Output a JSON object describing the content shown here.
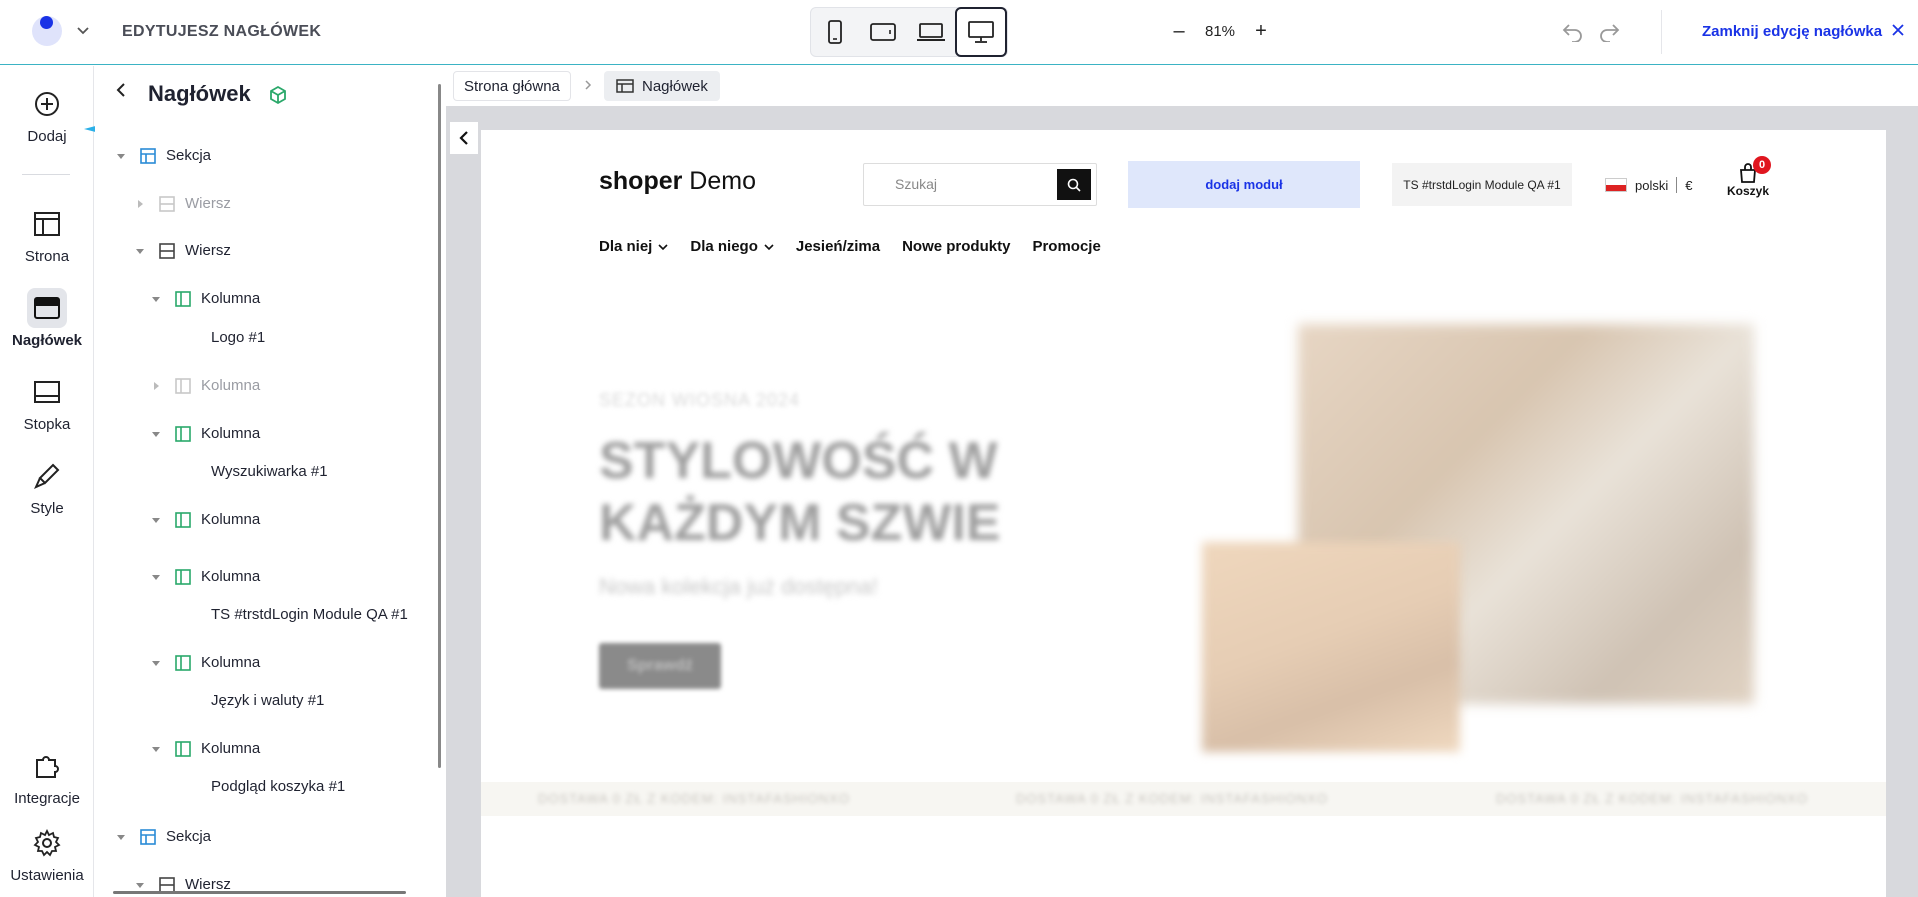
{
  "topbar": {
    "editing_label": "EDYTUJESZ NAGŁÓWEK",
    "devices": [
      "phone",
      "tablet",
      "laptop",
      "desktop"
    ],
    "active_device": "desktop",
    "zoom": "81%",
    "close_label": "Zamknij edycję nagłówka"
  },
  "rail": {
    "items": [
      {
        "label": "Dodaj",
        "icon": "plus-circle-icon"
      },
      {
        "label": "Strona",
        "icon": "layout-icon"
      },
      {
        "label": "Nagłówek",
        "icon": "header-icon",
        "active": true
      },
      {
        "label": "Stopka",
        "icon": "footer-icon"
      },
      {
        "label": "Style",
        "icon": "brush-icon"
      },
      {
        "label": "Integracje",
        "icon": "puzzle-icon"
      },
      {
        "label": "Ustawienia",
        "icon": "gear-icon"
      }
    ]
  },
  "tree": {
    "title": "Nagłówek",
    "nodes": [
      {
        "label": "Sekcja",
        "type": "section"
      },
      {
        "label": "Wiersz",
        "type": "row",
        "dim": true
      },
      {
        "label": "Wiersz",
        "type": "row"
      },
      {
        "label": "Kolumna",
        "type": "column"
      },
      {
        "label": "Logo #1",
        "type": "module"
      },
      {
        "label": "Kolumna",
        "type": "column",
        "dim": true
      },
      {
        "label": "Kolumna",
        "type": "column"
      },
      {
        "label": "Wyszukiwarka #1",
        "type": "module"
      },
      {
        "label": "Kolumna",
        "type": "column"
      },
      {
        "label": "Kolumna",
        "type": "column"
      },
      {
        "label": "TS #trstdLogin Module QA #1",
        "type": "module"
      },
      {
        "label": "Kolumna",
        "type": "column"
      },
      {
        "label": "Język i waluty #1",
        "type": "module"
      },
      {
        "label": "Kolumna",
        "type": "column"
      },
      {
        "label": "Podgląd koszyka #1",
        "type": "module"
      },
      {
        "label": "Sekcja",
        "type": "section"
      },
      {
        "label": "Wiersz",
        "type": "row"
      }
    ]
  },
  "breadcrumb": {
    "home": "Strona główna",
    "current": "Nagłówek"
  },
  "preview": {
    "brand_bold": "shoper",
    "brand_rest": " Demo",
    "search_placeholder": "Szukaj",
    "module_label": "dodaj moduł",
    "ts_label": "TS #trstdLogin Module QA #1",
    "language": "polski",
    "currency": "€",
    "cart_label": "Koszyk",
    "cart_count": "0",
    "nav": [
      "Dla niej",
      "Dla niego",
      "Jesień/zima",
      "Nowe produkty",
      "Promocje"
    ],
    "hero_tag": "SEZON WIOSNA 2024",
    "hero_title_1": "STYLOWOŚĆ W",
    "hero_title_2": "KAŻDYM SZWIE",
    "hero_sub": "Nowa kolekcja już dostępna!",
    "hero_button": "Sprawdź",
    "strip_text": "DOSTAWA 0 ZŁ Z KODEM: INSTAFASHIONXO"
  }
}
